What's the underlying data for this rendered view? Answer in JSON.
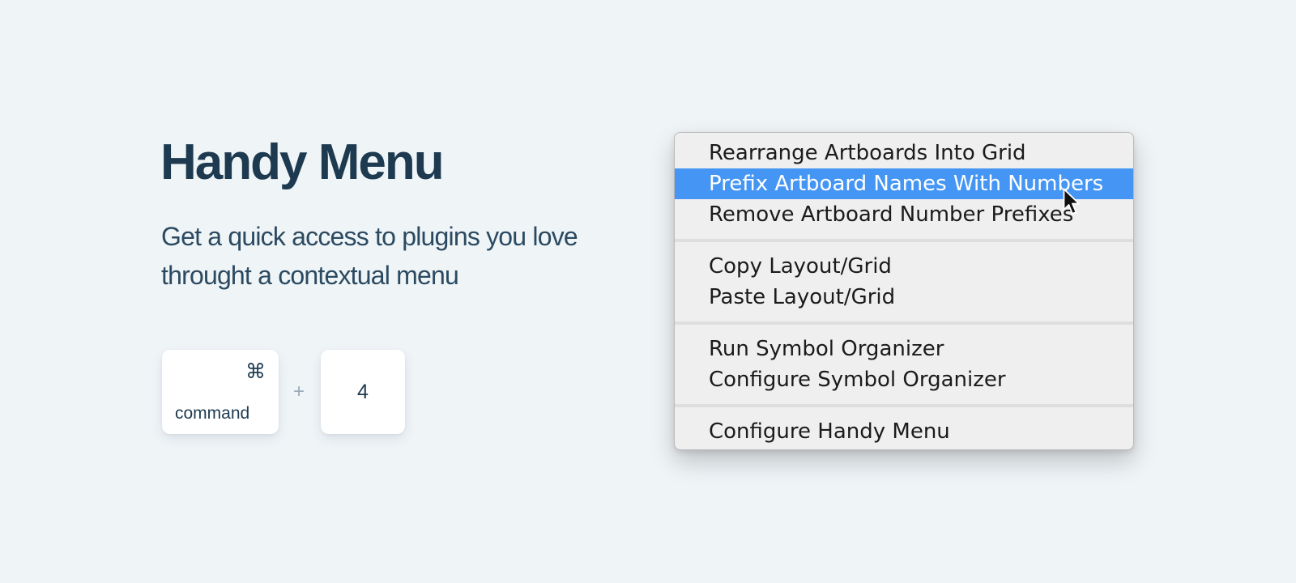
{
  "hero": {
    "title": "Handy Menu",
    "subtitle": "Get a quick access to plugins you love throught a contextual menu"
  },
  "shortcut": {
    "modifier_symbol": "⌘",
    "modifier_label": "command",
    "separator": "+",
    "key": "4"
  },
  "context_menu": {
    "highlight_color": "#4596f4",
    "groups": [
      {
        "items": [
          {
            "label": "Rearrange Artboards Into Grid",
            "highlighted": false
          },
          {
            "label": "Prefix Artboard Names With Numbers",
            "highlighted": true
          },
          {
            "label": "Remove Artboard Number Prefixes",
            "highlighted": false
          }
        ]
      },
      {
        "items": [
          {
            "label": "Copy Layout/Grid",
            "highlighted": false
          },
          {
            "label": "Paste Layout/Grid",
            "highlighted": false
          }
        ]
      },
      {
        "items": [
          {
            "label": "Run Symbol Organizer",
            "highlighted": false
          },
          {
            "label": "Configure Symbol Organizer",
            "highlighted": false
          }
        ]
      },
      {
        "items": [
          {
            "label": "Configure Handy Menu",
            "highlighted": false
          }
        ]
      }
    ]
  },
  "cursor": {
    "icon": "arrow-pointer-icon"
  }
}
